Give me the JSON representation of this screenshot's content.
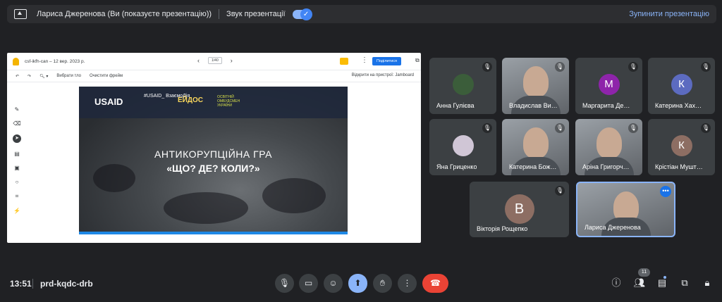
{
  "banner": {
    "title": "Лариса Джеренова (Ви (показуєте презентацію))",
    "sound_label": "Звук презентації",
    "stop_label": "Зупинити презентацію"
  },
  "jamboard": {
    "file_name": "csf-ikfh-can – 12 вер. 2023 р.",
    "page": "1/40",
    "share_label": "Поділитися",
    "tool_choose": "Вибрати тло",
    "tool_clear": "Очистити фрейм",
    "open_device": "Відкрити на пристрої: Jamboard",
    "slide": {
      "logo_usaid": "USAID",
      "logo_hashtag": "#USAID_ ВзаємоДія",
      "logo_eidos": "ЕЙДОС",
      "logo_osvita": "ОСВІТНІЙ ОМБУДСМЕН УКРАЇНИ",
      "title_line1": "АНТИКОРУПЦІЙНА ГРА",
      "title_line2": "«ЩО? ДЕ? КОЛИ?»"
    }
  },
  "participants": [
    {
      "name": "Анна Гулієва",
      "type": "photo-avatar",
      "color": "#3b5d3a"
    },
    {
      "name": "Владислав Ви…",
      "type": "video"
    },
    {
      "name": "Маргарита Де…",
      "type": "initial",
      "initial": "М",
      "color": "#8e24aa"
    },
    {
      "name": "Катерина Хах…",
      "type": "initial",
      "initial": "К",
      "color": "#5c6bc0"
    },
    {
      "name": "Яна Гриценко",
      "type": "photo-avatar",
      "color": "#d0c6d6"
    },
    {
      "name": "Катерина Бож…",
      "type": "video"
    },
    {
      "name": "Аріна Григорч…",
      "type": "video"
    },
    {
      "name": "Крістіан Мушт…",
      "type": "initial",
      "initial": "К",
      "color": "#8d6e63"
    },
    {
      "name": "Вікторія Рощепко",
      "type": "initial",
      "initial": "В",
      "color": "#8d6e63"
    },
    {
      "name": "Лариса Джеренова",
      "type": "video"
    }
  ],
  "bottom": {
    "time": "13:51",
    "meeting_code": "prd-kqdc-drb",
    "people_count": "11"
  },
  "colors": {
    "accent": "#8ab4f8",
    "end_call": "#ea4335",
    "background": "#202124"
  }
}
